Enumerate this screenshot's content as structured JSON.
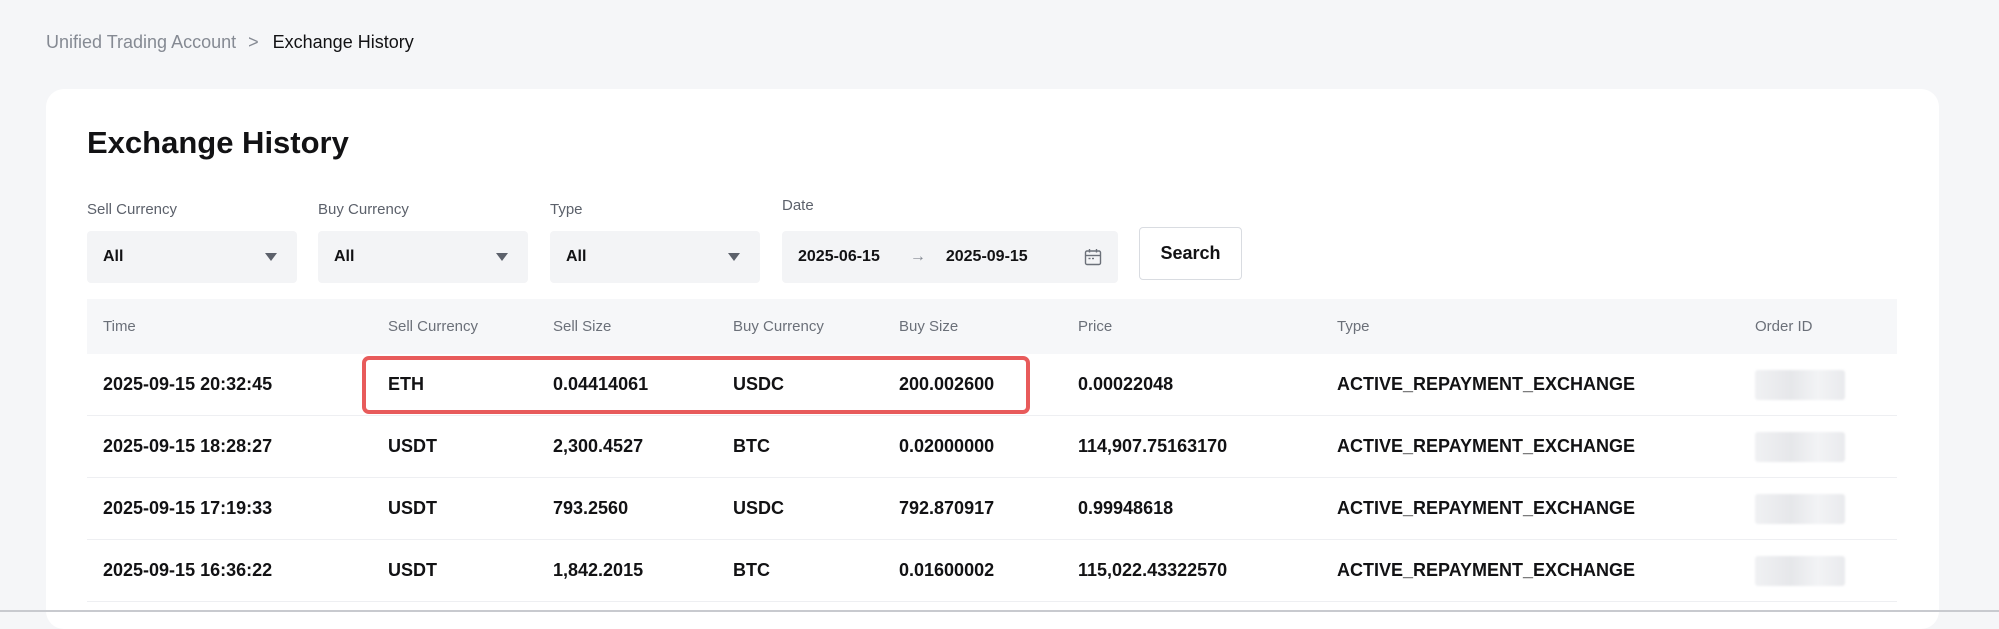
{
  "breadcrumb": {
    "parent": "Unified Trading Account",
    "separator": ">",
    "current": "Exchange History"
  },
  "page": {
    "title": "Exchange History"
  },
  "filters": {
    "sell_currency": {
      "label": "Sell Currency",
      "value": "All"
    },
    "buy_currency": {
      "label": "Buy Currency",
      "value": "All"
    },
    "type": {
      "label": "Type",
      "value": "All"
    },
    "date": {
      "label": "Date",
      "start": "2025-06-15",
      "arrow": "→",
      "end": "2025-09-15"
    },
    "search_label": "Search"
  },
  "table": {
    "columns": [
      "Time",
      "Sell Currency",
      "Sell Size",
      "Buy Currency",
      "Buy Size",
      "Price",
      "Type",
      "Order ID"
    ],
    "rows": [
      {
        "time": "2025-09-15 20:32:45",
        "sell_currency": "ETH",
        "sell_size": "0.04414061",
        "buy_currency": "USDC",
        "buy_size": "200.002600",
        "price": "0.00022048",
        "type": "ACTIVE_REPAYMENT_EXCHANGE"
      },
      {
        "time": "2025-09-15 18:28:27",
        "sell_currency": "USDT",
        "sell_size": "2,300.4527",
        "buy_currency": "BTC",
        "buy_size": "0.02000000",
        "price": "114,907.75163170",
        "type": "ACTIVE_REPAYMENT_EXCHANGE"
      },
      {
        "time": "2025-09-15 17:19:33",
        "sell_currency": "USDT",
        "sell_size": "793.2560",
        "buy_currency": "USDC",
        "buy_size": "792.870917",
        "price": "0.99948618",
        "type": "ACTIVE_REPAYMENT_EXCHANGE"
      },
      {
        "time": "2025-09-15 16:36:22",
        "sell_currency": "USDT",
        "sell_size": "1,842.2015",
        "buy_currency": "BTC",
        "buy_size": "0.01600002",
        "price": "115,022.43322570",
        "type": "ACTIVE_REPAYMENT_EXCHANGE"
      }
    ]
  },
  "colors": {
    "highlight": "#e85b5b",
    "background": "#f5f6f8"
  },
  "icons": {
    "caret": "caret-down-icon",
    "calendar": "calendar-icon",
    "breadcrumb_separator": "chevron-right-icon"
  }
}
